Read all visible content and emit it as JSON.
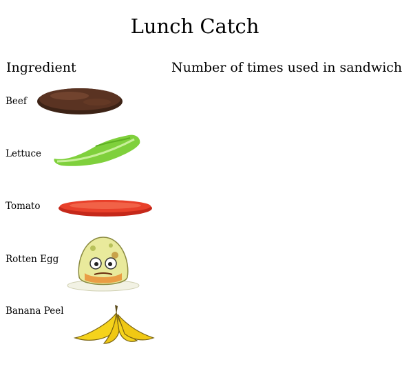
{
  "page": {
    "title": "Lunch Catch"
  },
  "table": {
    "headers": {
      "ingredient": "Ingredient",
      "count": "Number of times used in sandwich"
    },
    "rows": [
      {
        "label": "Beef",
        "icon": "beef-patty-icon",
        "count": ""
      },
      {
        "label": "Lettuce",
        "icon": "lettuce-leaf-icon",
        "count": ""
      },
      {
        "label": "Tomato",
        "icon": "tomato-slice-icon",
        "count": ""
      },
      {
        "label": "Rotten Egg",
        "icon": "rotten-egg-icon",
        "count": ""
      },
      {
        "label": "Banana Peel",
        "icon": "banana-peel-icon",
        "count": ""
      }
    ]
  },
  "colors": {
    "beef": "#5a3322",
    "lettuce": "#7fd03c",
    "tomato": "#e8402a",
    "egg": "#e9ea9c",
    "banana": "#f5d31c"
  }
}
